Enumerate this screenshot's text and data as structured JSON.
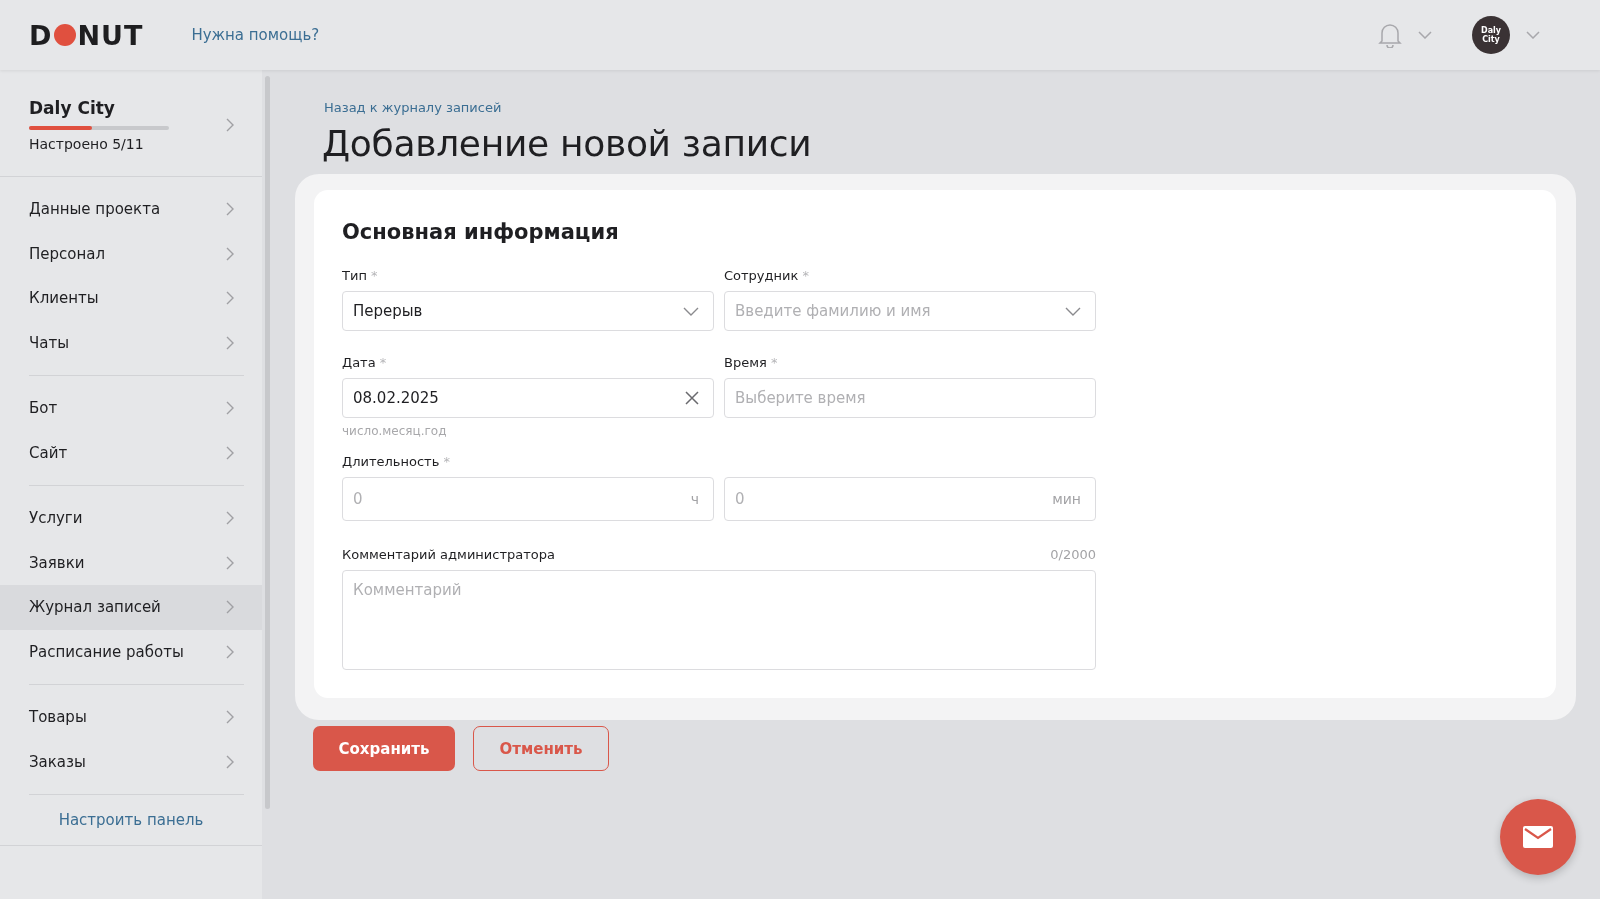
{
  "header": {
    "logo": {
      "left": "D",
      "right": "NUT"
    },
    "help_link": "Нужна помощь?",
    "avatar_text": "Daly City"
  },
  "sidebar": {
    "project": {
      "name": "Daly City",
      "progress_label": "Настроено 5/11",
      "level": 0.45
    },
    "groups": [
      {
        "items": [
          {
            "label": "Данные проекта",
            "selected": false
          },
          {
            "label": "Персонал",
            "selected": false
          },
          {
            "label": "Клиенты",
            "selected": false
          },
          {
            "label": "Чаты",
            "selected": false
          }
        ]
      },
      {
        "items": [
          {
            "label": "Бот",
            "selected": false
          },
          {
            "label": "Сайт",
            "selected": false
          }
        ]
      },
      {
        "items": [
          {
            "label": "Услуги",
            "selected": false
          },
          {
            "label": "Заявки",
            "selected": false
          },
          {
            "label": "Журнал записей",
            "selected": true
          },
          {
            "label": "Расписание работы",
            "selected": false
          }
        ]
      },
      {
        "items": [
          {
            "label": "Товары",
            "selected": false
          },
          {
            "label": "Заказы",
            "selected": false
          }
        ]
      }
    ],
    "configure_link": "Настроить панель"
  },
  "breadcrumb": "Назад к журналу записей",
  "title": "Добавление новой записи",
  "form": {
    "section_title": "Основная информация",
    "type": {
      "label": "Тип",
      "required_mark": "*",
      "value": "Перерыв"
    },
    "employee": {
      "label": "Сотрудник",
      "required_mark": "*",
      "placeholder": "Введите фамилию и имя"
    },
    "date": {
      "label": "Дата",
      "required_mark": "*",
      "value": "08.02.2025",
      "hint": "число.месяц.год"
    },
    "time": {
      "label": "Время",
      "required_mark": "*",
      "placeholder": "Выберите время"
    },
    "duration": {
      "label": "Длительность",
      "required_mark": "*",
      "hours": {
        "placeholder": "0",
        "unit": "ч"
      },
      "minutes": {
        "placeholder": "0",
        "unit": "мин"
      }
    },
    "comment": {
      "label": "Комментарий администратора",
      "counter": "0/2000",
      "placeholder": "Комментарий"
    }
  },
  "buttons": {
    "save": "Сохранить",
    "cancel": "Отменить"
  }
}
